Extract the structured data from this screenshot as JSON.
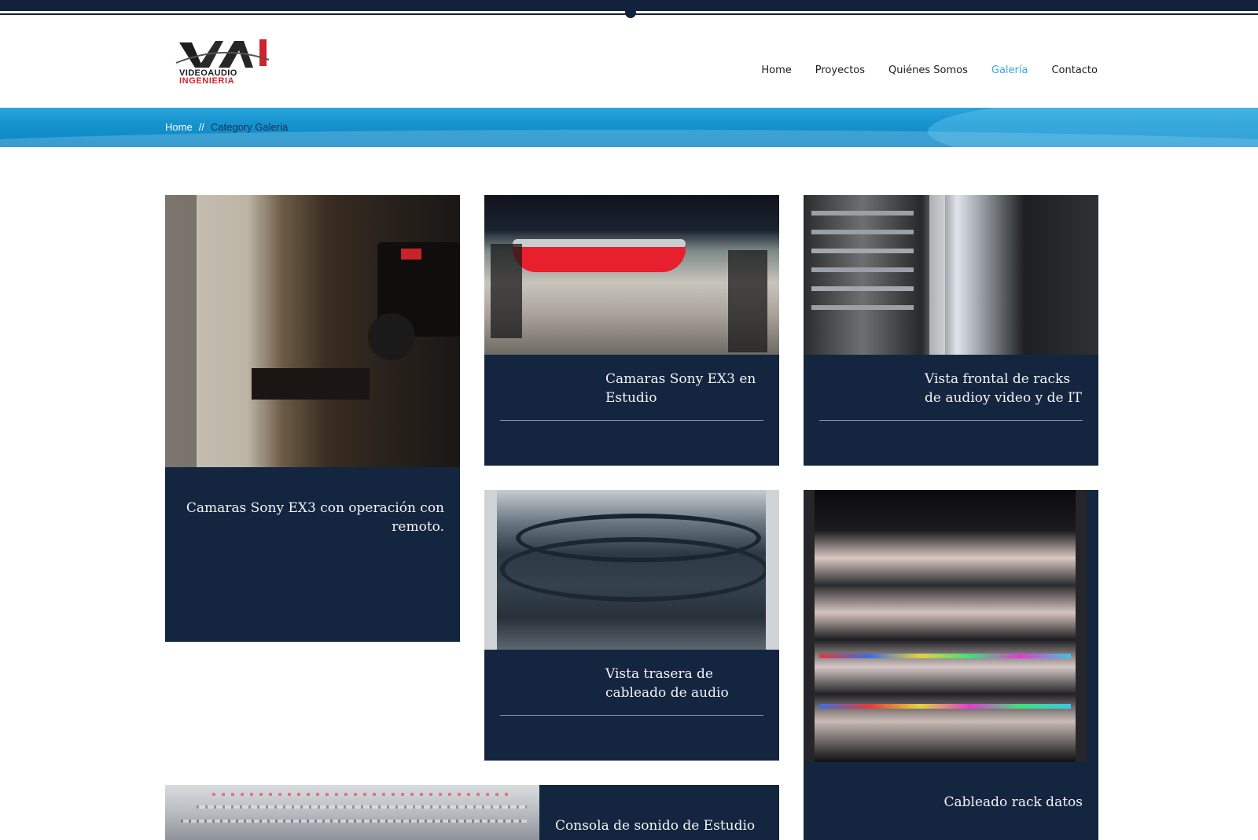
{
  "brand": {
    "logo_mark": "VAI",
    "logo_line1": "VIDEOAUDIO",
    "logo_line2": "INGENIERIA",
    "colors": {
      "dark_navy": "#13223c",
      "accent_blue": "#3aa6d6",
      "logo_red": "#d1232a"
    }
  },
  "nav": {
    "items": [
      {
        "label": "Home",
        "active": false
      },
      {
        "label": "Proyectos",
        "active": false
      },
      {
        "label": "Quiénes Somos",
        "active": false
      },
      {
        "label": "Galería",
        "active": true
      },
      {
        "label": "Contacto",
        "active": false
      }
    ]
  },
  "breadcrumb": {
    "home": "Home",
    "separator": "//",
    "current": "Category Galeria"
  },
  "gallery": {
    "items": [
      {
        "caption": "Camaras Sony EX3 con operación con remoto.",
        "photo": "camera-remote-photo"
      },
      {
        "caption": "Camaras Sony EX3 en Estudio",
        "photo": "studio-set-photo"
      },
      {
        "caption": "Vista frontal de racks de audioy video y de IT",
        "photo": "racks-front-photo"
      },
      {
        "caption": "Vista trasera de cableado de audio",
        "photo": "audio-cabling-photo"
      },
      {
        "caption": "Cableado rack datos",
        "photo": "data-rack-photo"
      },
      {
        "caption": "Consola de sonido de Estudio",
        "photo": "sound-console-photo"
      }
    ]
  }
}
